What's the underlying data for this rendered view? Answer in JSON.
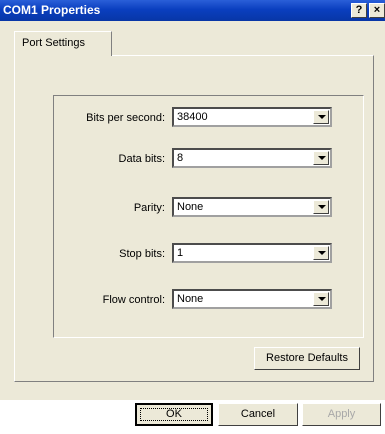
{
  "window": {
    "title": "COM1 Properties",
    "help_label": "?",
    "close_label": "×"
  },
  "tabs": [
    {
      "label": "Port Settings",
      "active": true
    }
  ],
  "settings": [
    {
      "label": "Bits per second:",
      "value": "38400"
    },
    {
      "label": "Data bits:",
      "value": "8"
    },
    {
      "label": "Parity:",
      "value": "None"
    },
    {
      "label": "Stop bits:",
      "value": "1"
    },
    {
      "label": "Flow control:",
      "value": "None"
    }
  ],
  "buttons": {
    "restore": "Restore Defaults",
    "ok": "OK",
    "cancel": "Cancel",
    "apply": "Apply"
  }
}
